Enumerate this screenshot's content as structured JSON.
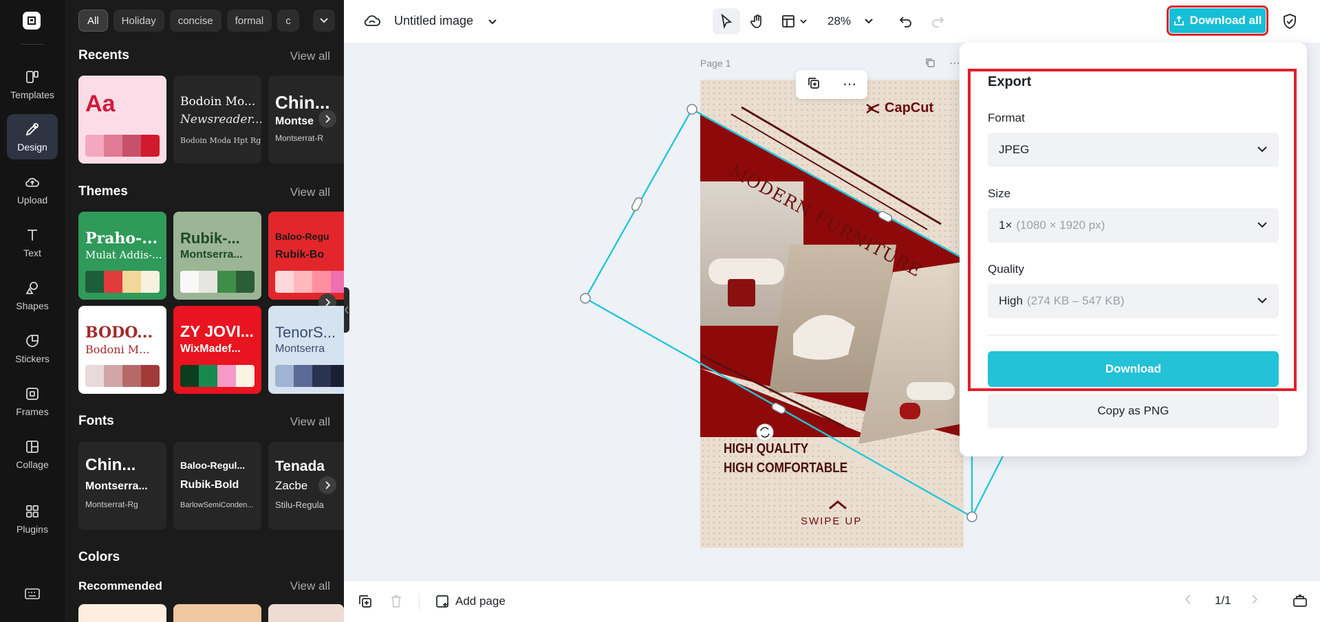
{
  "rail": {
    "items": [
      {
        "label": "Templates",
        "icon": "templates-icon"
      },
      {
        "label": "Design",
        "icon": "design-icon"
      },
      {
        "label": "Upload",
        "icon": "upload-icon"
      },
      {
        "label": "Text",
        "icon": "text-icon"
      },
      {
        "label": "Shapes",
        "icon": "shapes-icon"
      },
      {
        "label": "Stickers",
        "icon": "stickers-icon"
      },
      {
        "label": "Frames",
        "icon": "frames-icon"
      },
      {
        "label": "Collage",
        "icon": "collage-icon"
      },
      {
        "label": "Plugins",
        "icon": "plugins-icon"
      }
    ]
  },
  "panel": {
    "chips": [
      "All",
      "Holiday",
      "concise",
      "formal",
      "c"
    ],
    "recents": {
      "title": "Recents",
      "view_all": "View all",
      "cards": [
        {
          "t1": "Aa"
        },
        {
          "t1": "Bodoin Mo...",
          "t2": "Newsreader...",
          "t3": "Bodoin Moda Hpt Rg"
        },
        {
          "t1": "Chin...",
          "t2": "Montse",
          "t3": "Montserrat-R"
        }
      ]
    },
    "themes": {
      "title": "Themes",
      "view_all": "View all",
      "cards": [
        {
          "t1": "Praho-...",
          "t2": "Mulat Addis-..."
        },
        {
          "t1": "Rubik-...",
          "t2": "Montserra..."
        },
        {
          "t1": "Baloo-Regu",
          "t2": "Rubik-Bo"
        },
        {
          "t1": "BODO...",
          "t2": "Bodoni M..."
        },
        {
          "t1": "ZY JOVI...",
          "t2": "WixMadef..."
        },
        {
          "t1": "TenorS...",
          "t2": "Montserra"
        }
      ]
    },
    "fonts": {
      "title": "Fonts",
      "view_all": "View all",
      "cards": [
        {
          "t1": "Chin...",
          "t2": "Montserra...",
          "t3": "Montserrat-Rg"
        },
        {
          "t1": "Baloo-Regul...",
          "t2": "Rubik-Bold",
          "t3": "BarlowSemiConden..."
        },
        {
          "t1": "Tenada",
          "t2": "Zacbe",
          "t3": "Stilu-Regula"
        }
      ]
    },
    "colors": {
      "title": "Colors",
      "recommended": "Recommended",
      "view_all": "View all"
    }
  },
  "topbar": {
    "doc_title": "Untitled image",
    "zoom": "28%",
    "download_all": "Download all"
  },
  "canvas": {
    "page_label": "Page 1",
    "poster": {
      "brand": "CapCut",
      "headline": "MODERN FURNITURE",
      "line1": "HIGH QUALITY",
      "line2": "HIGH COMFORTABLE",
      "swipe": "SWIPE UP"
    }
  },
  "export": {
    "title": "Export",
    "format_label": "Format",
    "format_value": "JPEG",
    "size_label": "Size",
    "size_value": "1×",
    "size_detail": "(1080 × 1920 px)",
    "quality_label": "Quality",
    "quality_value": "High",
    "quality_detail": "(274 KB – 547 KB)",
    "download_label": "Download",
    "copy_label": "Copy as PNG"
  },
  "bottombar": {
    "add_page": "Add page",
    "page_counter": "1/1"
  },
  "colors": {
    "accent": "#23c2d8",
    "highlight": "#e0202b",
    "poster_red": "#8e0a0a",
    "poster_bg": "#e9ded0"
  }
}
